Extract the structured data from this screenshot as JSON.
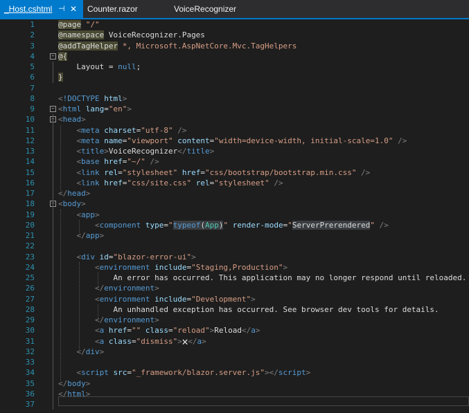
{
  "tabs": [
    {
      "label": "_Host.cshtml",
      "active": true,
      "pin": "⊣",
      "close": "✕"
    },
    {
      "label": "Counter.razor",
      "active": false
    },
    {
      "label": "VoiceRecognizer",
      "active": false
    }
  ],
  "colors": {
    "accent": "#007acc",
    "background": "#1e1e1e",
    "line_number": "#2b91af"
  },
  "lines": [
    {
      "n": "1",
      "segs": [
        [
          "rz",
          "@page"
        ],
        [
          "str",
          " \"/\""
        ]
      ]
    },
    {
      "n": "2",
      "segs": [
        [
          "rz",
          "@namespace"
        ],
        [
          "txt",
          " VoiceRecognizer.Pages"
        ]
      ]
    },
    {
      "n": "3",
      "segs": [
        [
          "rz",
          "@addTagHelper"
        ],
        [
          "str",
          " *, Microsoft.AspNetCore.Mvc.TagHelpers"
        ]
      ]
    },
    {
      "n": "4",
      "segs": [
        [
          "rz",
          "@{"
        ]
      ]
    },
    {
      "n": "5",
      "segs": [
        [
          "txt",
          "    Layout = "
        ],
        [
          "kw",
          "null"
        ],
        [
          "txt",
          ";"
        ]
      ]
    },
    {
      "n": "6",
      "segs": [
        [
          "rz",
          "}"
        ]
      ]
    },
    {
      "n": "7",
      "segs": []
    },
    {
      "n": "8",
      "segs": [
        [
          "gray",
          "<"
        ],
        [
          "tag",
          "!DOCTYPE "
        ],
        [
          "attr",
          "html"
        ],
        [
          "gray",
          ">"
        ]
      ]
    },
    {
      "n": "9",
      "segs": [
        [
          "gray",
          "<"
        ],
        [
          "tag",
          "html "
        ],
        [
          "attr",
          "lang"
        ],
        [
          "txt",
          "="
        ],
        [
          "str",
          "\"en\""
        ],
        [
          "gray",
          ">"
        ]
      ]
    },
    {
      "n": "10",
      "segs": [
        [
          "gray",
          "<"
        ],
        [
          "tag",
          "head"
        ],
        [
          "gray",
          ">"
        ]
      ]
    },
    {
      "n": "11",
      "segs": [
        [
          "txt",
          "    "
        ],
        [
          "gray",
          "<"
        ],
        [
          "tag",
          "meta "
        ],
        [
          "attr",
          "charset"
        ],
        [
          "txt",
          "="
        ],
        [
          "str",
          "\"utf-8\""
        ],
        [
          "txt",
          " "
        ],
        [
          "gray",
          "/>"
        ]
      ]
    },
    {
      "n": "12",
      "segs": [
        [
          "txt",
          "    "
        ],
        [
          "gray",
          "<"
        ],
        [
          "tag",
          "meta "
        ],
        [
          "attr",
          "name"
        ],
        [
          "txt",
          "="
        ],
        [
          "str",
          "\"viewport\""
        ],
        [
          "txt",
          " "
        ],
        [
          "attr",
          "content"
        ],
        [
          "txt",
          "="
        ],
        [
          "str",
          "\"width=device-width, initial-scale=1.0\""
        ],
        [
          "txt",
          " "
        ],
        [
          "gray",
          "/>"
        ]
      ]
    },
    {
      "n": "13",
      "segs": [
        [
          "txt",
          "    "
        ],
        [
          "gray",
          "<"
        ],
        [
          "tag",
          "title"
        ],
        [
          "gray",
          ">"
        ],
        [
          "txt",
          "VoiceRecognizer"
        ],
        [
          "gray",
          "</"
        ],
        [
          "tag",
          "title"
        ],
        [
          "gray",
          ">"
        ]
      ]
    },
    {
      "n": "14",
      "segs": [
        [
          "txt",
          "    "
        ],
        [
          "gray",
          "<"
        ],
        [
          "tag",
          "base "
        ],
        [
          "attr",
          "href"
        ],
        [
          "txt",
          "="
        ],
        [
          "str",
          "\"~/\""
        ],
        [
          "txt",
          " "
        ],
        [
          "gray",
          "/>"
        ]
      ]
    },
    {
      "n": "15",
      "segs": [
        [
          "txt",
          "    "
        ],
        [
          "gray",
          "<"
        ],
        [
          "tag",
          "link "
        ],
        [
          "attr",
          "rel"
        ],
        [
          "txt",
          "="
        ],
        [
          "str",
          "\"stylesheet\""
        ],
        [
          "txt",
          " "
        ],
        [
          "attr",
          "href"
        ],
        [
          "txt",
          "="
        ],
        [
          "str",
          "\"css/bootstrap/bootstrap.min.css\""
        ],
        [
          "txt",
          " "
        ],
        [
          "gray",
          "/>"
        ]
      ]
    },
    {
      "n": "16",
      "segs": [
        [
          "txt",
          "    "
        ],
        [
          "gray",
          "<"
        ],
        [
          "tag",
          "link "
        ],
        [
          "attr",
          "href"
        ],
        [
          "txt",
          "="
        ],
        [
          "str",
          "\"css/site.css\""
        ],
        [
          "txt",
          " "
        ],
        [
          "attr",
          "rel"
        ],
        [
          "txt",
          "="
        ],
        [
          "str",
          "\"stylesheet\""
        ],
        [
          "txt",
          " "
        ],
        [
          "gray",
          "/>"
        ]
      ]
    },
    {
      "n": "17",
      "segs": [
        [
          "gray",
          "</"
        ],
        [
          "tag",
          "head"
        ],
        [
          "gray",
          ">"
        ]
      ]
    },
    {
      "n": "18",
      "segs": [
        [
          "gray",
          "<"
        ],
        [
          "tag",
          "body"
        ],
        [
          "gray",
          ">"
        ]
      ]
    },
    {
      "n": "19",
      "segs": [
        [
          "txt",
          "    "
        ],
        [
          "gray",
          "<"
        ],
        [
          "tag",
          "app"
        ],
        [
          "gray",
          ">"
        ]
      ]
    },
    {
      "n": "20",
      "segs": [
        [
          "txt",
          "        "
        ],
        [
          "gray",
          "<"
        ],
        [
          "tag",
          "component "
        ],
        [
          "attr",
          "type"
        ],
        [
          "txt",
          "="
        ],
        [
          "str",
          "\""
        ],
        [
          "hi kw",
          "typeof"
        ],
        [
          "hi txt",
          "("
        ],
        [
          "hi ty",
          "App"
        ],
        [
          "hi txt",
          ")"
        ],
        [
          "str",
          "\""
        ],
        [
          "txt",
          " "
        ],
        [
          "attr",
          "render-mode"
        ],
        [
          "txt",
          "="
        ],
        [
          "str",
          "\""
        ],
        [
          "hi txt",
          "ServerPrerendered"
        ],
        [
          "str",
          "\""
        ],
        [
          "txt",
          " "
        ],
        [
          "gray",
          "/>"
        ]
      ]
    },
    {
      "n": "21",
      "segs": [
        [
          "txt",
          "    "
        ],
        [
          "gray",
          "</"
        ],
        [
          "tag",
          "app"
        ],
        [
          "gray",
          ">"
        ]
      ]
    },
    {
      "n": "22",
      "segs": []
    },
    {
      "n": "23",
      "segs": [
        [
          "txt",
          "    "
        ],
        [
          "gray",
          "<"
        ],
        [
          "tag",
          "div "
        ],
        [
          "attr",
          "id"
        ],
        [
          "txt",
          "="
        ],
        [
          "str",
          "\"blazor-error-ui\""
        ],
        [
          "gray",
          ">"
        ]
      ]
    },
    {
      "n": "24",
      "segs": [
        [
          "txt",
          "        "
        ],
        [
          "gray",
          "<"
        ],
        [
          "tag",
          "environment "
        ],
        [
          "attr",
          "include"
        ],
        [
          "txt",
          "="
        ],
        [
          "str",
          "\"Staging,Production\""
        ],
        [
          "gray",
          ">"
        ]
      ]
    },
    {
      "n": "25",
      "segs": [
        [
          "txt",
          "            An error has occurred. This application may no longer respond until reloaded."
        ]
      ]
    },
    {
      "n": "26",
      "segs": [
        [
          "txt",
          "        "
        ],
        [
          "gray",
          "</"
        ],
        [
          "tag",
          "environment"
        ],
        [
          "gray",
          ">"
        ]
      ]
    },
    {
      "n": "27",
      "segs": [
        [
          "txt",
          "        "
        ],
        [
          "gray",
          "<"
        ],
        [
          "tag",
          "environment "
        ],
        [
          "attr",
          "include"
        ],
        [
          "txt",
          "="
        ],
        [
          "str",
          "\"Development\""
        ],
        [
          "gray",
          ">"
        ]
      ]
    },
    {
      "n": "28",
      "segs": [
        [
          "txt",
          "            An unhandled exception has occurred. See browser dev tools for details."
        ]
      ]
    },
    {
      "n": "29",
      "segs": [
        [
          "txt",
          "        "
        ],
        [
          "gray",
          "</"
        ],
        [
          "tag",
          "environment"
        ],
        [
          "gray",
          ">"
        ]
      ]
    },
    {
      "n": "30",
      "segs": [
        [
          "txt",
          "        "
        ],
        [
          "gray",
          "<"
        ],
        [
          "tag",
          "a "
        ],
        [
          "attr",
          "href"
        ],
        [
          "txt",
          "="
        ],
        [
          "str",
          "\"\""
        ],
        [
          "txt",
          " "
        ],
        [
          "attr",
          "class"
        ],
        [
          "txt",
          "="
        ],
        [
          "str",
          "\"reload\""
        ],
        [
          "gray",
          ">"
        ],
        [
          "txt",
          "Reload"
        ],
        [
          "gray",
          "</"
        ],
        [
          "tag",
          "a"
        ],
        [
          "gray",
          ">"
        ]
      ]
    },
    {
      "n": "31",
      "segs": [
        [
          "txt",
          "        "
        ],
        [
          "gray",
          "<"
        ],
        [
          "tag",
          "a "
        ],
        [
          "attr",
          "class"
        ],
        [
          "txt",
          "="
        ],
        [
          "str",
          "\"dismiss\""
        ],
        [
          "gray",
          ">"
        ],
        [
          "txt",
          "🗙"
        ],
        [
          "gray",
          "</"
        ],
        [
          "tag",
          "a"
        ],
        [
          "gray",
          ">"
        ]
      ]
    },
    {
      "n": "32",
      "segs": [
        [
          "txt",
          "    "
        ],
        [
          "gray",
          "</"
        ],
        [
          "tag",
          "div"
        ],
        [
          "gray",
          ">"
        ]
      ]
    },
    {
      "n": "33",
      "segs": []
    },
    {
      "n": "34",
      "segs": [
        [
          "txt",
          "    "
        ],
        [
          "gray",
          "<"
        ],
        [
          "tag",
          "script "
        ],
        [
          "attr",
          "src"
        ],
        [
          "txt",
          "="
        ],
        [
          "str",
          "\"_framework/blazor.server.js\""
        ],
        [
          "gray",
          ">"
        ],
        [
          "gray",
          "</"
        ],
        [
          "tag",
          "script"
        ],
        [
          "gray",
          ">"
        ]
      ]
    },
    {
      "n": "35",
      "segs": [
        [
          "gray",
          "</"
        ],
        [
          "tag",
          "body"
        ],
        [
          "gray",
          ">"
        ]
      ]
    },
    {
      "n": "36",
      "segs": [
        [
          "gray",
          "</"
        ],
        [
          "tag",
          "html"
        ],
        [
          "gray",
          ">"
        ]
      ]
    },
    {
      "n": "37",
      "segs": []
    }
  ]
}
